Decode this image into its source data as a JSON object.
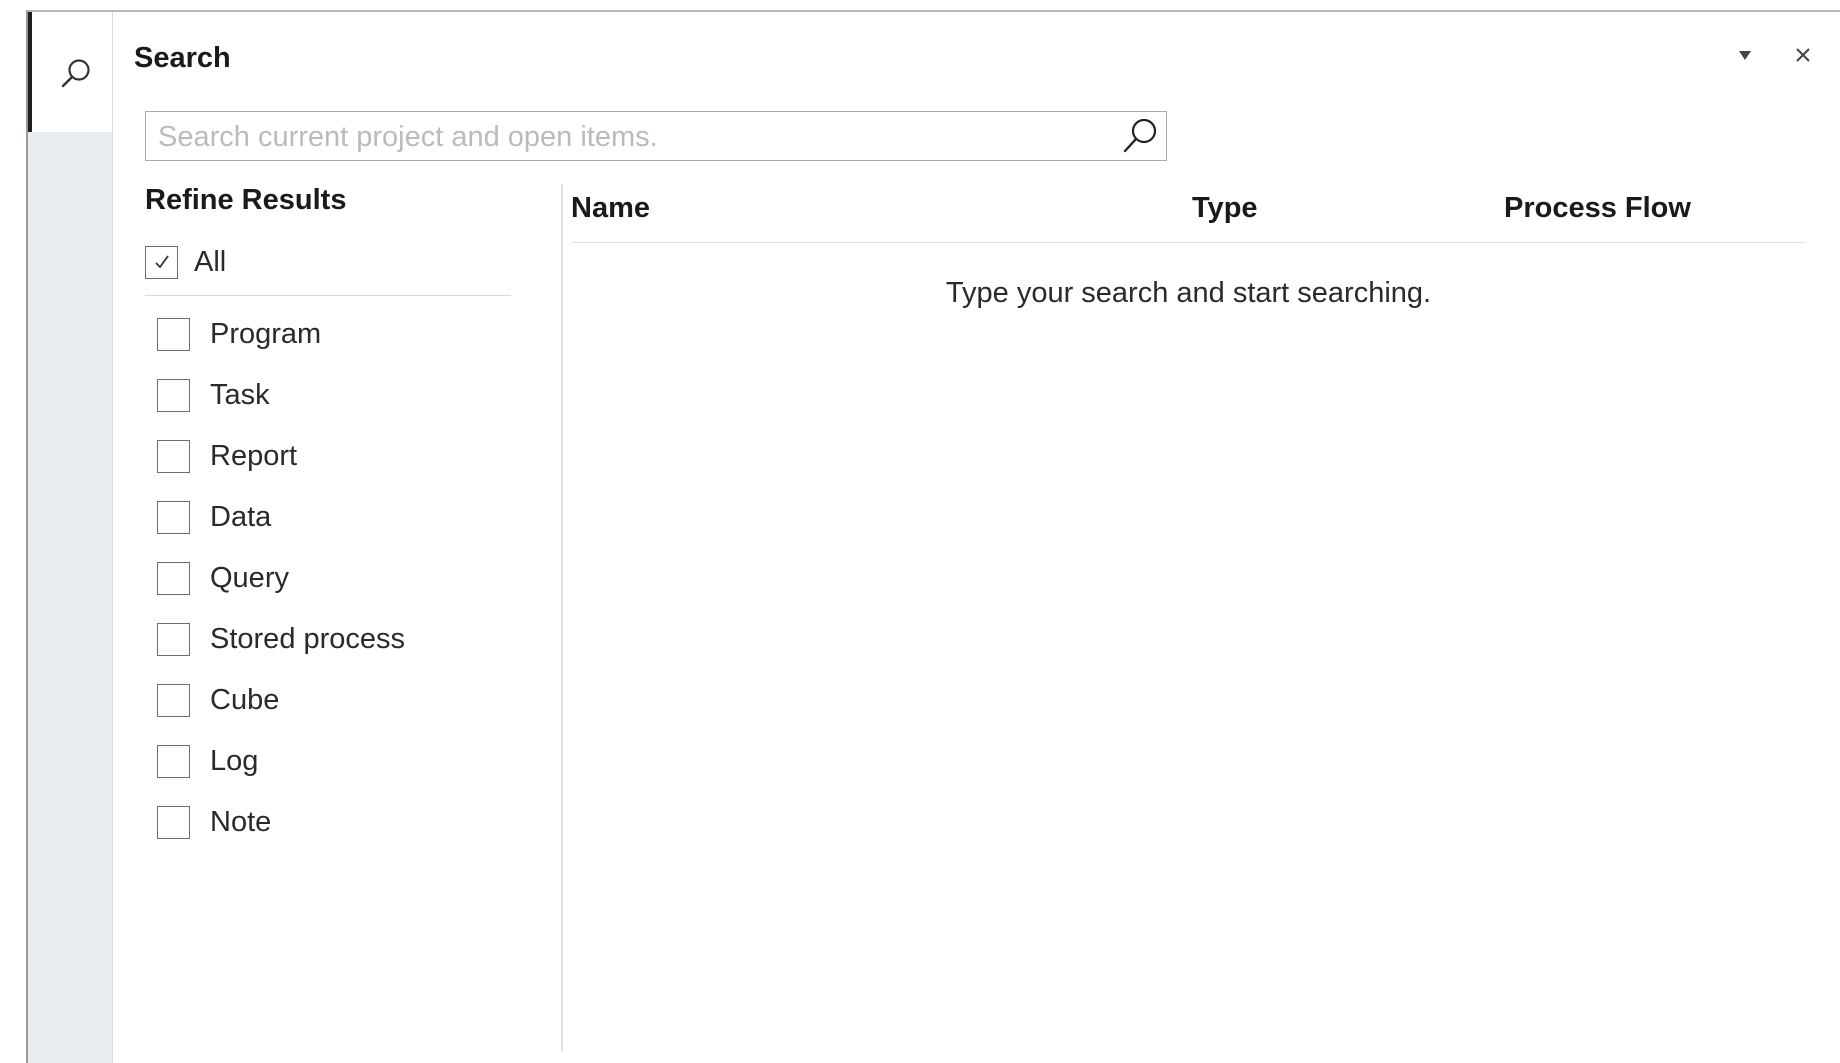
{
  "side_tab": {
    "icon": "search-icon"
  },
  "header": {
    "title": "Search",
    "menu_icon": "dropdown-triangle-icon",
    "close_icon": "close-icon"
  },
  "search": {
    "placeholder": "Search current project and open items.",
    "value": "",
    "button_icon": "search-icon"
  },
  "refine": {
    "title": "Refine Results",
    "all": {
      "label": "All",
      "checked": true
    },
    "items": [
      {
        "label": "Program",
        "checked": false
      },
      {
        "label": "Task",
        "checked": false
      },
      {
        "label": "Report",
        "checked": false
      },
      {
        "label": "Data",
        "checked": false
      },
      {
        "label": "Query",
        "checked": false
      },
      {
        "label": "Stored process",
        "checked": false
      },
      {
        "label": "Cube",
        "checked": false
      },
      {
        "label": "Log",
        "checked": false
      },
      {
        "label": "Note",
        "checked": false
      }
    ]
  },
  "results": {
    "columns": {
      "name": "Name",
      "type": "Type",
      "process_flow": "Process Flow"
    },
    "empty_message": "Type your search and start searching."
  }
}
